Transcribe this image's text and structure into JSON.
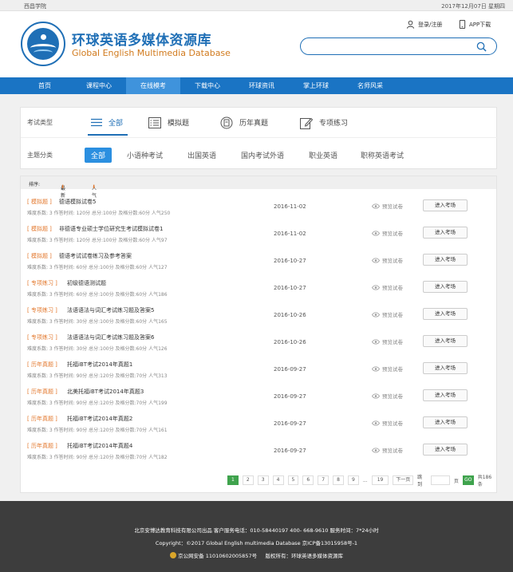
{
  "topbar": {
    "left": "西昌学院",
    "right": "2017年12月07日 星期四"
  },
  "header": {
    "title": "环球英语多媒体资源库",
    "subtitle": "Global English Multimedia Database",
    "login": "登录/注册",
    "app": "APP下载",
    "search_placeholder": ""
  },
  "nav": [
    "首页",
    "课程中心",
    "在线模考",
    "下载中心",
    "环球资讯",
    "掌上环球",
    "名师风采"
  ],
  "filter": {
    "type_label": "考试类型",
    "types": [
      "全部",
      "模拟题",
      "历年真题",
      "专项练习"
    ],
    "topic_label": "主题分类",
    "topics": [
      "全部",
      "小语种考试",
      "出国英语",
      "国内考试外语",
      "职业英语",
      "职称英语考试"
    ]
  },
  "sortbar": {
    "label": "排序:",
    "latest": "最新",
    "popular": "人气"
  },
  "list_labels": {
    "preview": "预览试卷",
    "enter": "进入考场"
  },
  "exams": [
    {
      "tag": "[ 模拟题 ]",
      "name": "德语模拟试卷5",
      "meta": "难度系数: 3  作答时间: 120分  总分:100分  及格分数:60分  人气250",
      "date": "2016-11-02"
    },
    {
      "tag": "[ 模拟题 ]",
      "name": "非德语专业硕士学位研究生考试模拟试卷1",
      "meta": "难度系数: 3  作答时间: 120分  总分:100分  及格分数:60分  人气97",
      "date": "2016-11-02"
    },
    {
      "tag": "[ 模拟题 ]",
      "name": "德语考试试卷练习及参考答案",
      "meta": "难度系数: 3  作答时间: 60分  总分:100分  及格分数:60分  人气127",
      "date": "2016-10-27"
    },
    {
      "tag": "[ 专项练习 ]",
      "name": "初级德语测试题",
      "meta": "难度系数: 3  作答时间: 60分  总分:100分  及格分数:60分  人气186",
      "date": "2016-10-27"
    },
    {
      "tag": "[ 专项练习 ]",
      "name": "法语语法与词汇考试练习题及答案5",
      "meta": "难度系数: 3  作答时间: 30分  总分:100分  及格分数:60分  人气165",
      "date": "2016-10-26"
    },
    {
      "tag": "[ 专项练习 ]",
      "name": "法语语法与词汇考试练习题及答案6",
      "meta": "难度系数: 3  作答时间: 30分  总分:100分  及格分数:60分  人气126",
      "date": "2016-10-26"
    },
    {
      "tag": "[ 历年真题 ]",
      "name": "托福iBT考试2014年真题1",
      "meta": "难度系数: 3  作答时间: 90分  总分:120分  及格分数:70分  人气313",
      "date": "2016-09-27"
    },
    {
      "tag": "[ 历年真题 ]",
      "name": "北美托福iBT考试2014年真题3",
      "meta": "难度系数: 3  作答时间: 90分  总分:120分  及格分数:70分  人气199",
      "date": "2016-09-27"
    },
    {
      "tag": "[ 历年真题 ]",
      "name": "托福iBT考试2014年真题2",
      "meta": "难度系数: 3  作答时间: 90分  总分:120分  及格分数:70分  人气161",
      "date": "2016-09-27"
    },
    {
      "tag": "[ 历年真题 ]",
      "name": "托福iBT考试2014年真题4",
      "meta": "难度系数: 3  作答时间: 90分  总分:120分  及格分数:70分  人气182",
      "date": "2016-09-27"
    }
  ],
  "pager": {
    "pages": [
      "1",
      "2",
      "3",
      "4",
      "5",
      "6",
      "7",
      "8",
      "9"
    ],
    "ellipsis": "...",
    "last": "19",
    "next": "下一页",
    "goto": "跳到",
    "page_unit": "页",
    "go": "GO",
    "total": "共186条"
  },
  "footer": {
    "line1": "北京安博达教育科技有限公司出品    客户服务电话：010-58440197    400- 668-9610    服务时间：7*24小时",
    "line2": "Copyright：©2017 Global English multimedia Database    京ICP备13015958号-1",
    "line3_a": "京公网安备 11010602005857号",
    "line3_b": "版权所有：环球英语多媒体资源库"
  }
}
